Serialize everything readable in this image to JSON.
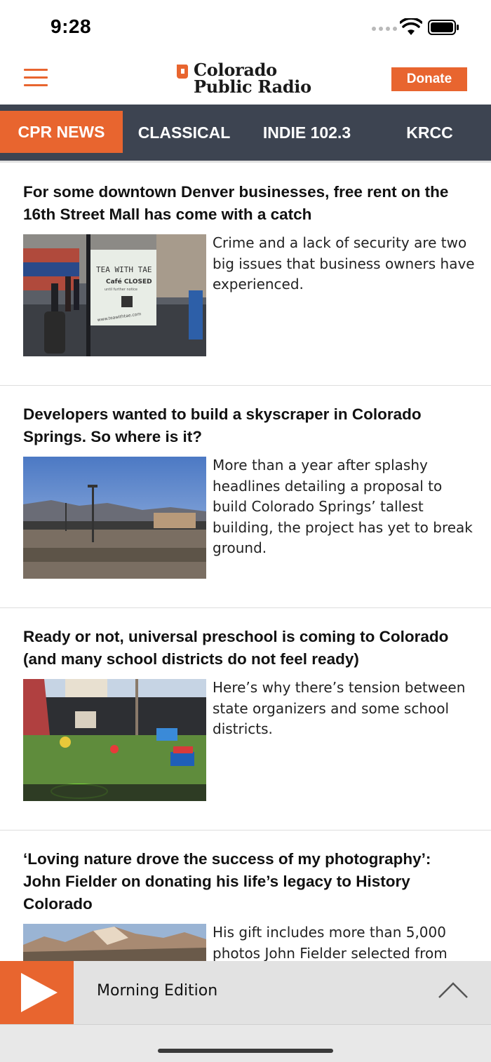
{
  "status_bar": {
    "time": "9:28"
  },
  "header": {
    "logo_line1": "Colorado",
    "logo_line2": "Public Radio",
    "donate_label": "Donate",
    "accent_color": "#e8652f"
  },
  "stations": {
    "tabs": [
      {
        "label": "CPR NEWS",
        "active": true
      },
      {
        "label": "CLASSICAL",
        "active": false
      },
      {
        "label": "INDIE 102.3",
        "active": false
      },
      {
        "label": "KRCC",
        "active": false
      }
    ],
    "bar_color": "#3d4451"
  },
  "articles": [
    {
      "title": "For some downtown Denver businesses, free rent on the 16th Street Mall has come with a catch",
      "summary": "Crime and a lack of security are two big issues that business owners have experienced.",
      "image_sign_line1": "TEA WITH TAE",
      "image_sign_line2": "Café CLOSED",
      "image_sign_line3": "until further notice",
      "image_sign_line4": "www.teawithtae.com"
    },
    {
      "title": "Developers wanted to build a skyscraper in Colorado Springs. So where is it?",
      "summary": "More than a year after splashy headlines detailing a proposal to build Colorado Springs’ tallest building, the project has yet to break ground."
    },
    {
      "title": "Ready or not, universal preschool is coming to Colorado (and many school districts do not feel ready)",
      "summary": "Here’s why there’s tension between state organizers and some school districts."
    },
    {
      "title": "‘Loving nature drove the success of my photography’: John Fielder on donating his life’s legacy to History Colorado",
      "summary": "His gift includes more than 5,000 photos John Fielder selected from"
    }
  ],
  "player": {
    "now_playing": "Morning Edition"
  }
}
